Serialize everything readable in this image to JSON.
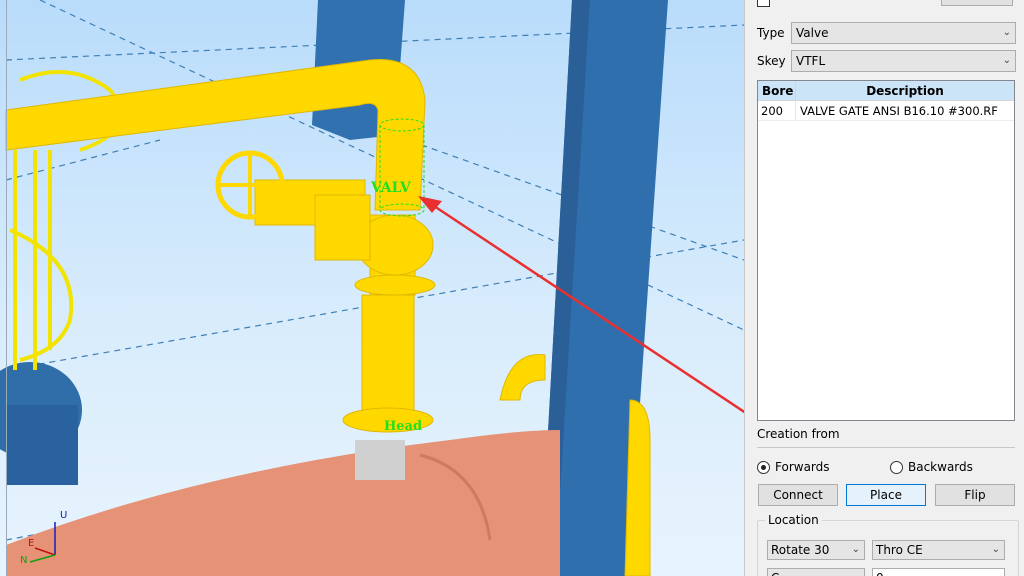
{
  "scene": {
    "labels": {
      "valve": "VALV",
      "head": "Head"
    },
    "axes": {
      "u": "U",
      "e": "E",
      "n": "N"
    },
    "colors": {
      "pipe": "#ffd800",
      "steel": "#2e6fb0",
      "vessel": "#e58f72",
      "annotation": "#20e020",
      "pointer": "#e83030"
    }
  },
  "panel": {
    "type_label": "Type",
    "type_value": "Valve",
    "skey_label": "Skey",
    "skey_value": "VTFL",
    "list": {
      "headers": {
        "bore": "Bore",
        "description": "Description"
      },
      "rows": [
        {
          "bore": "200",
          "description": "VALVE GATE ANSI B16.10 #300.RF"
        }
      ]
    },
    "creation_from_label": "Creation from",
    "radio_forwards": "Forwards",
    "radio_backwards": "Backwards",
    "buttons": {
      "connect": "Connect",
      "place": "Place",
      "flip": "Flip"
    },
    "location_label": "Location",
    "rotate_value": "Rotate 30",
    "thro_value": "Thro CE",
    "partial_left": "C",
    "partial_right": "0"
  }
}
